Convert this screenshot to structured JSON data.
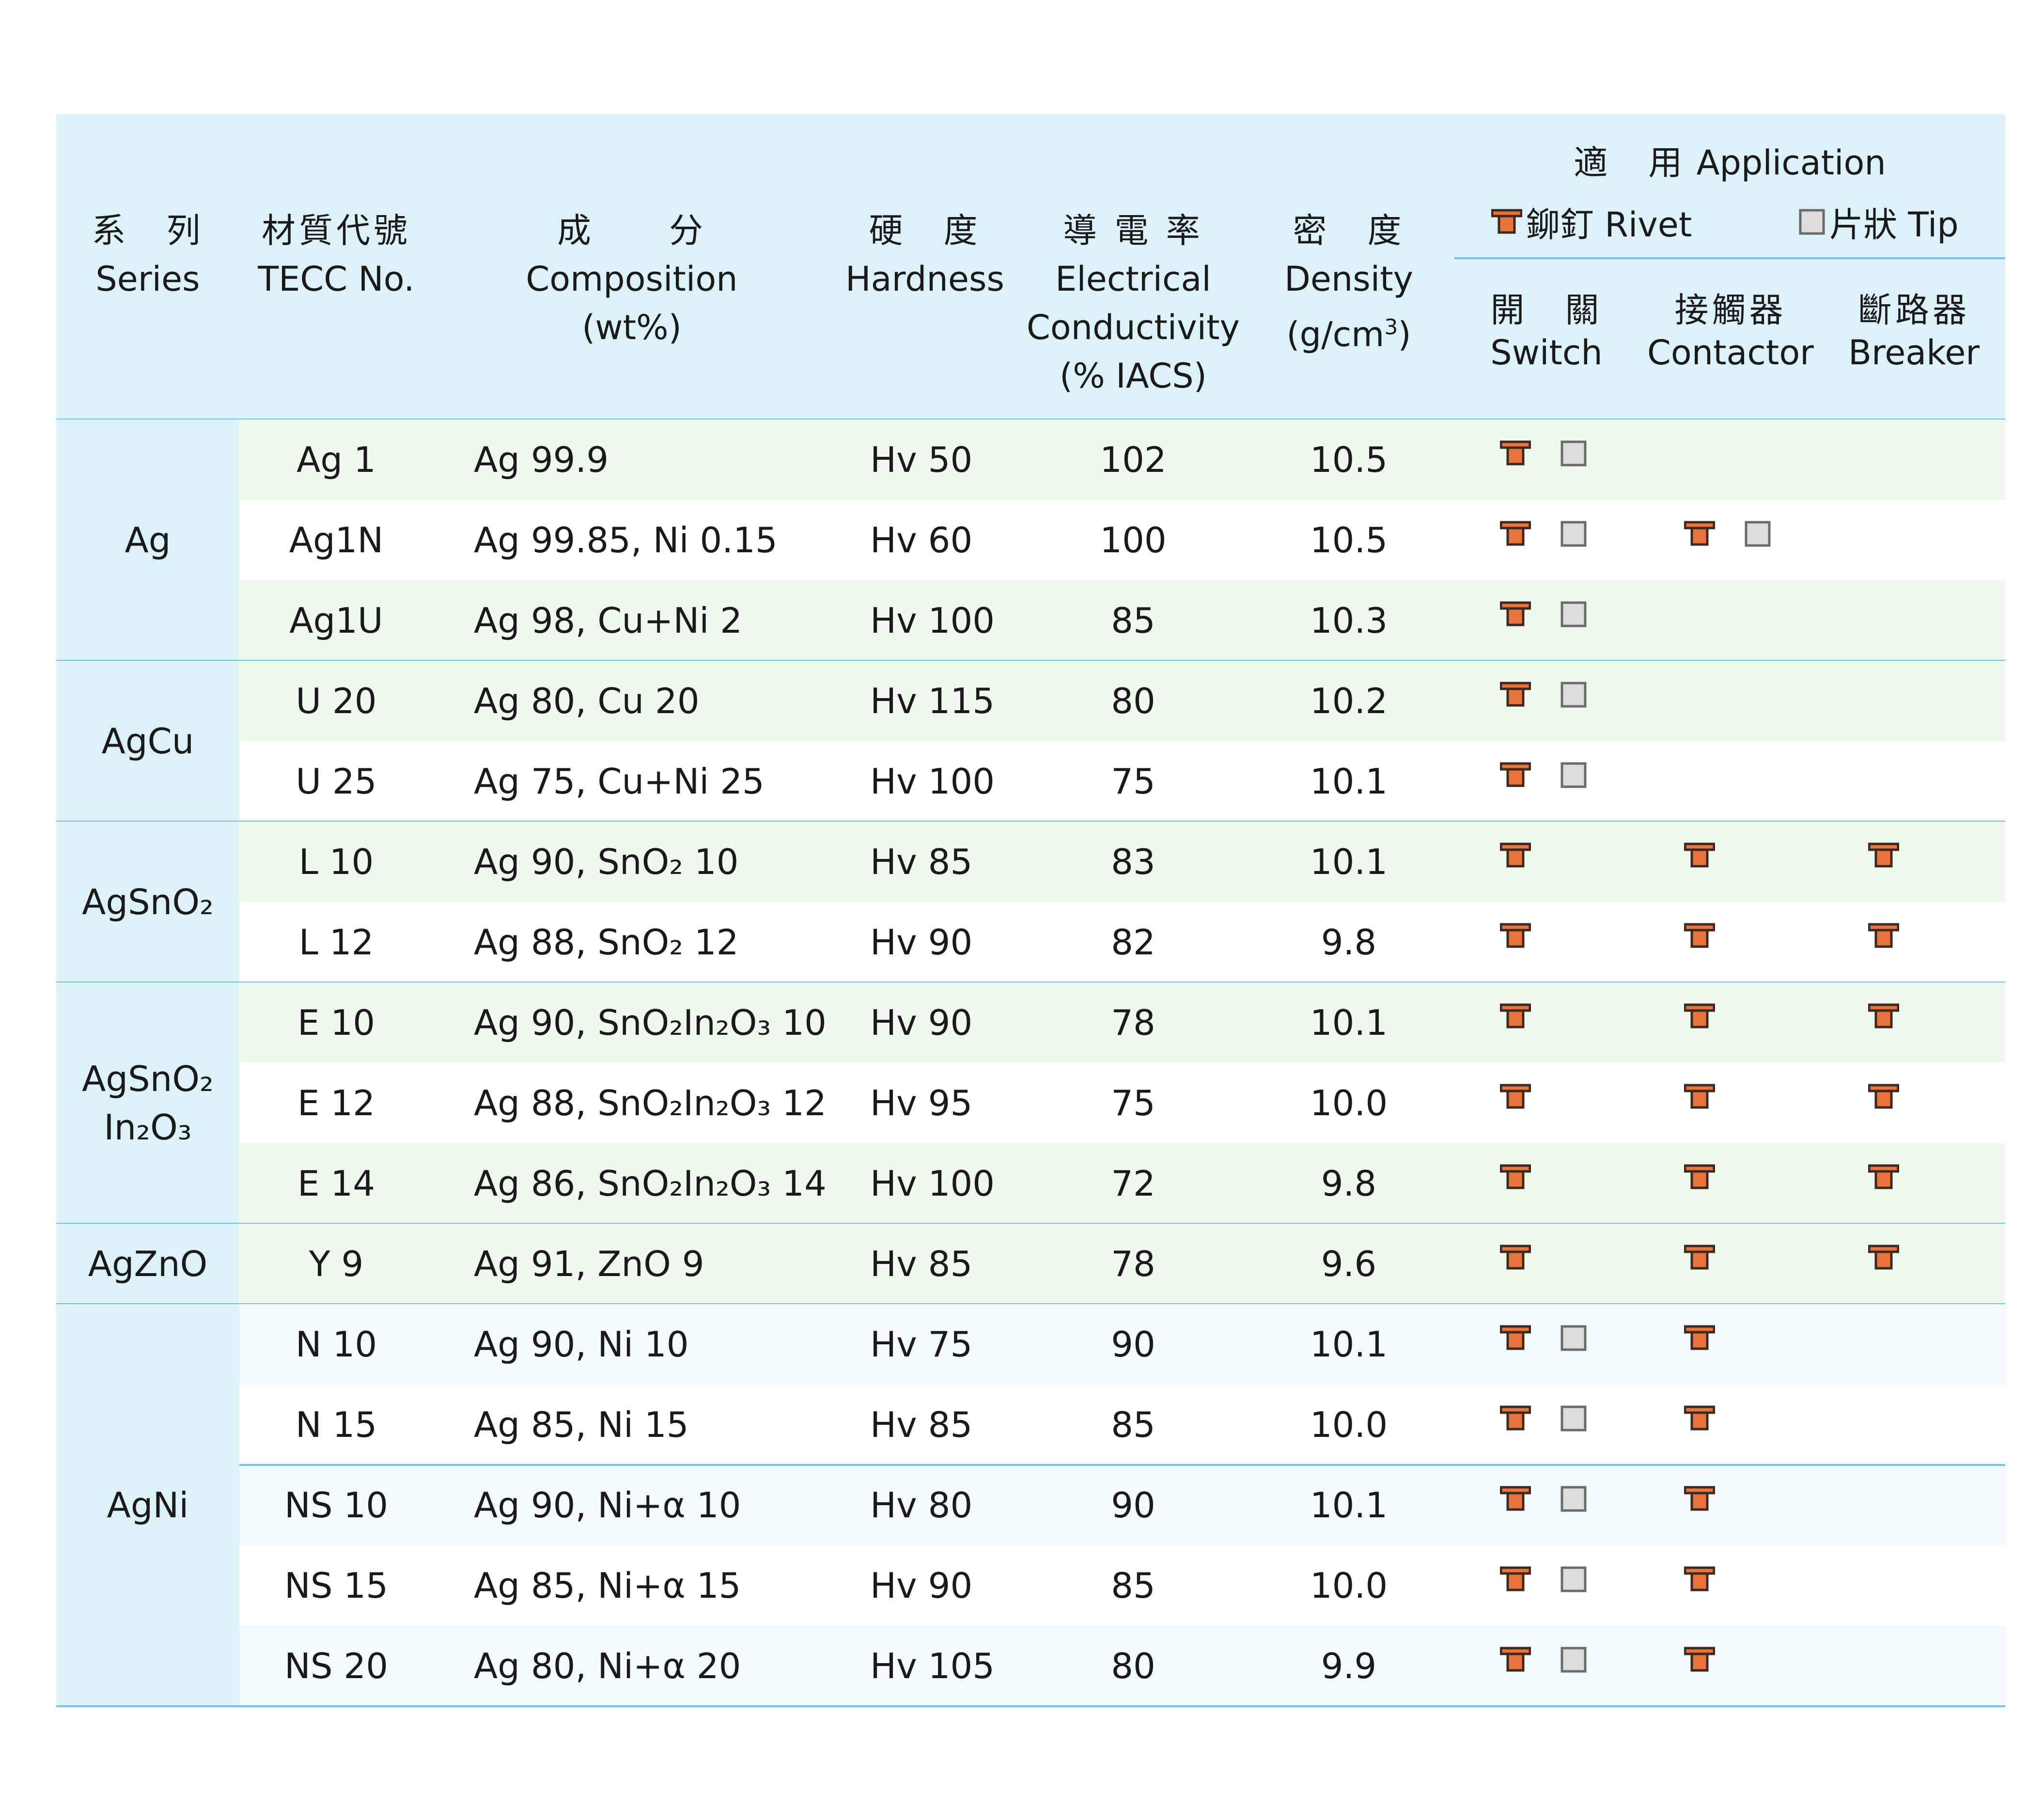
{
  "colors": {
    "header_bg": "#ddf1f9",
    "series_bg": "#ddf1f9",
    "row_alt_bg": "#f0f9ee",
    "row_plain_bg": "#ffffff",
    "agni_row_bg": "#f2fafd",
    "rule": "#6cc7e6",
    "rivet_fill": "#e8743b",
    "rivet_stroke": "#3a2a22",
    "tip_fill": "#dcdcdc",
    "tip_stroke": "#6b6b6b"
  },
  "header": {
    "series": {
      "zh": "系　列",
      "en": "Series"
    },
    "tecc": {
      "zh": "材質代號",
      "en": "TECC No."
    },
    "composition": {
      "zh": "成　　分",
      "en": "Composition",
      "unit": "(wt%)"
    },
    "hardness": {
      "zh": "硬　度",
      "en": "Hardness"
    },
    "conductivity": {
      "zh": "導 電 率",
      "en1": "Electrical",
      "en2": "Conductivity",
      "unit": "(% IACS)"
    },
    "density": {
      "zh": "密　度",
      "en": "Density",
      "unit_pre": "(g/cm",
      "unit_sup": "3",
      "unit_post": ")"
    },
    "application": {
      "zh": "適　用",
      "en": "Application",
      "rivet_legend": "鉚釘 Rivet",
      "tip_legend": "片狀 Tip",
      "switch": {
        "zh": "開　關",
        "en": "Switch"
      },
      "contactor": {
        "zh": "接觸器",
        "en": "Contactor"
      },
      "breaker": {
        "zh": "斷路器",
        "en": "Breaker"
      }
    }
  },
  "groups": [
    {
      "series": "Ag",
      "rows": 3
    },
    {
      "series": "AgCu",
      "rows": 2
    },
    {
      "series": "AgSnO₂",
      "rows": 2
    },
    {
      "series": "AgSnO₂\nIn₂O₃",
      "rows": 3
    },
    {
      "series": "AgZnO",
      "rows": 1
    },
    {
      "series": "AgNi",
      "rows": 5
    }
  ],
  "rows": [
    {
      "tecc": "Ag 1",
      "composition": "Ag 99.9",
      "hardness": "Hv 50",
      "conductivity": "102",
      "density": "10.5",
      "switch": [
        "rivet",
        "tip"
      ],
      "contactor": [],
      "breaker": []
    },
    {
      "tecc": "Ag1N",
      "composition": "Ag 99.85, Ni 0.15",
      "hardness": "Hv 60",
      "conductivity": "100",
      "density": "10.5",
      "switch": [
        "rivet",
        "tip"
      ],
      "contactor": [
        "rivet",
        "tip"
      ],
      "breaker": []
    },
    {
      "tecc": "Ag1U",
      "composition": "Ag 98, Cu+Ni 2",
      "hardness": "Hv 100",
      "conductivity": "85",
      "density": "10.3",
      "switch": [
        "rivet",
        "tip"
      ],
      "contactor": [],
      "breaker": []
    },
    {
      "tecc": "U 20",
      "composition": "Ag 80, Cu 20",
      "hardness": "Hv 115",
      "conductivity": "80",
      "density": "10.2",
      "switch": [
        "rivet",
        "tip"
      ],
      "contactor": [],
      "breaker": []
    },
    {
      "tecc": "U 25",
      "composition": "Ag 75, Cu+Ni 25",
      "hardness": "Hv 100",
      "conductivity": "75",
      "density": "10.1",
      "switch": [
        "rivet",
        "tip"
      ],
      "contactor": [],
      "breaker": []
    },
    {
      "tecc": "L 10",
      "composition": "Ag 90, SnO₂ 10",
      "hardness": "Hv 85",
      "conductivity": "83",
      "density": "10.1",
      "switch": [
        "rivet"
      ],
      "contactor": [
        "rivet"
      ],
      "breaker": [
        "rivet"
      ]
    },
    {
      "tecc": "L 12",
      "composition": "Ag 88, SnO₂ 12",
      "hardness": "Hv 90",
      "conductivity": "82",
      "density": "9.8",
      "switch": [
        "rivet"
      ],
      "contactor": [
        "rivet"
      ],
      "breaker": [
        "rivet"
      ]
    },
    {
      "tecc": "E 10",
      "composition": "Ag 90, SnO₂In₂O₃ 10",
      "hardness": "Hv 90",
      "conductivity": "78",
      "density": "10.1",
      "switch": [
        "rivet"
      ],
      "contactor": [
        "rivet"
      ],
      "breaker": [
        "rivet"
      ]
    },
    {
      "tecc": "E 12",
      "composition": "Ag 88, SnO₂In₂O₃ 12",
      "hardness": "Hv 95",
      "conductivity": "75",
      "density": "10.0",
      "switch": [
        "rivet"
      ],
      "contactor": [
        "rivet"
      ],
      "breaker": [
        "rivet"
      ]
    },
    {
      "tecc": "E 14",
      "composition": "Ag 86, SnO₂In₂O₃ 14",
      "hardness": "Hv 100",
      "conductivity": "72",
      "density": "9.8",
      "switch": [
        "rivet"
      ],
      "contactor": [
        "rivet"
      ],
      "breaker": [
        "rivet"
      ]
    },
    {
      "tecc": "Y 9",
      "composition": "Ag 91, ZnO 9",
      "hardness": "Hv 85",
      "conductivity": "78",
      "density": "9.6",
      "switch": [
        "rivet"
      ],
      "contactor": [
        "rivet"
      ],
      "breaker": [
        "rivet"
      ]
    },
    {
      "tecc": "N 10",
      "composition": "Ag 90, Ni 10",
      "hardness": "Hv 75",
      "conductivity": "90",
      "density": "10.1",
      "switch": [
        "rivet",
        "tip"
      ],
      "contactor": [
        "rivet"
      ],
      "breaker": []
    },
    {
      "tecc": "N 15",
      "composition": "Ag 85, Ni 15",
      "hardness": "Hv 85",
      "conductivity": "85",
      "density": "10.0",
      "switch": [
        "rivet",
        "tip"
      ],
      "contactor": [
        "rivet"
      ],
      "breaker": []
    },
    {
      "tecc": "NS 10",
      "composition": "Ag 90, Ni+α 10",
      "hardness": "Hv 80",
      "conductivity": "90",
      "density": "10.1",
      "switch": [
        "rivet",
        "tip"
      ],
      "contactor": [
        "rivet"
      ],
      "breaker": []
    },
    {
      "tecc": "NS 15",
      "composition": "Ag 85, Ni+α 15",
      "hardness": "Hv 90",
      "conductivity": "85",
      "density": "10.0",
      "switch": [
        "rivet",
        "tip"
      ],
      "contactor": [
        "rivet"
      ],
      "breaker": []
    },
    {
      "tecc": "NS 20",
      "composition": "Ag 80, Ni+α 20",
      "hardness": "Hv 105",
      "conductivity": "80",
      "density": "9.9",
      "switch": [
        "rivet",
        "tip"
      ],
      "contactor": [
        "rivet"
      ],
      "breaker": []
    }
  ]
}
